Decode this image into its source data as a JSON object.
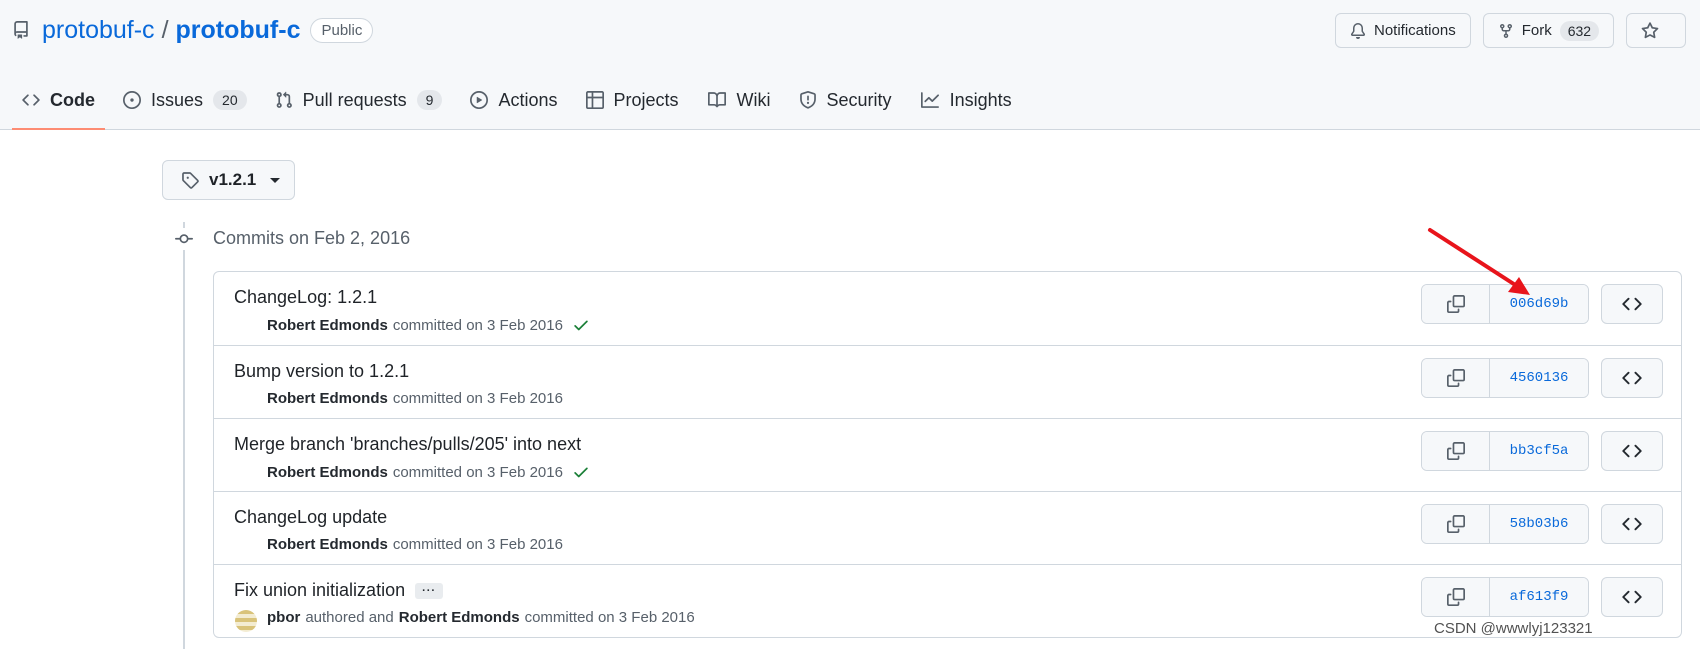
{
  "header": {
    "owner": "protobuf-c",
    "separator": "/",
    "repo": "protobuf-c",
    "visibility": "Public",
    "actions": {
      "notifications_label": "Notifications",
      "fork_label": "Fork",
      "fork_count": "632"
    }
  },
  "tabs": [
    {
      "label": "Code",
      "icon": "code-icon",
      "count": null,
      "selected": true
    },
    {
      "label": "Issues",
      "icon": "issue-opened-icon",
      "count": "20"
    },
    {
      "label": "Pull requests",
      "icon": "git-pull-request-icon",
      "count": "9"
    },
    {
      "label": "Actions",
      "icon": "play-icon"
    },
    {
      "label": "Projects",
      "icon": "table-icon"
    },
    {
      "label": "Wiki",
      "icon": "book-icon"
    },
    {
      "label": "Security",
      "icon": "shield-icon"
    },
    {
      "label": "Insights",
      "icon": "graph-icon"
    }
  ],
  "branch_selector": {
    "label": "v1.2.1",
    "icon": "tag-icon"
  },
  "timeline": {
    "heading": "Commits on Feb 2, 2016"
  },
  "commits": [
    {
      "title": "ChangeLog: 1.2.1",
      "author": "Robert Edmonds",
      "meta_text": "committed on 3 Feb 2016",
      "check": true,
      "sha": "006d69b"
    },
    {
      "title": "Bump version to 1.2.1",
      "author": "Robert Edmonds",
      "meta_text": "committed on 3 Feb 2016",
      "check": false,
      "sha": "4560136"
    },
    {
      "title": "Merge branch 'branches/pulls/205' into next",
      "author": "Robert Edmonds",
      "meta_text": "committed on 3 Feb 2016",
      "check": true,
      "sha": "bb3cf5a"
    },
    {
      "title": "ChangeLog update",
      "author": "Robert Edmonds",
      "meta_text": "committed on 3 Feb 2016",
      "check": false,
      "sha": "58b03b6"
    },
    {
      "title": "Fix union initialization",
      "ellipsis": "···",
      "coauthor": "pbor",
      "coauthor_text": "authored and",
      "author": "Robert Edmonds",
      "meta_text": "committed on 3 Feb 2016",
      "check": false,
      "sha": "af613f9"
    }
  ],
  "colors": {
    "accent_link": "#0969da",
    "tab_underline": "#fd8c73",
    "check_green": "#1a7f37",
    "annotation_red": "#e8141b"
  },
  "watermark": "CSDN @wwwlyj123321"
}
